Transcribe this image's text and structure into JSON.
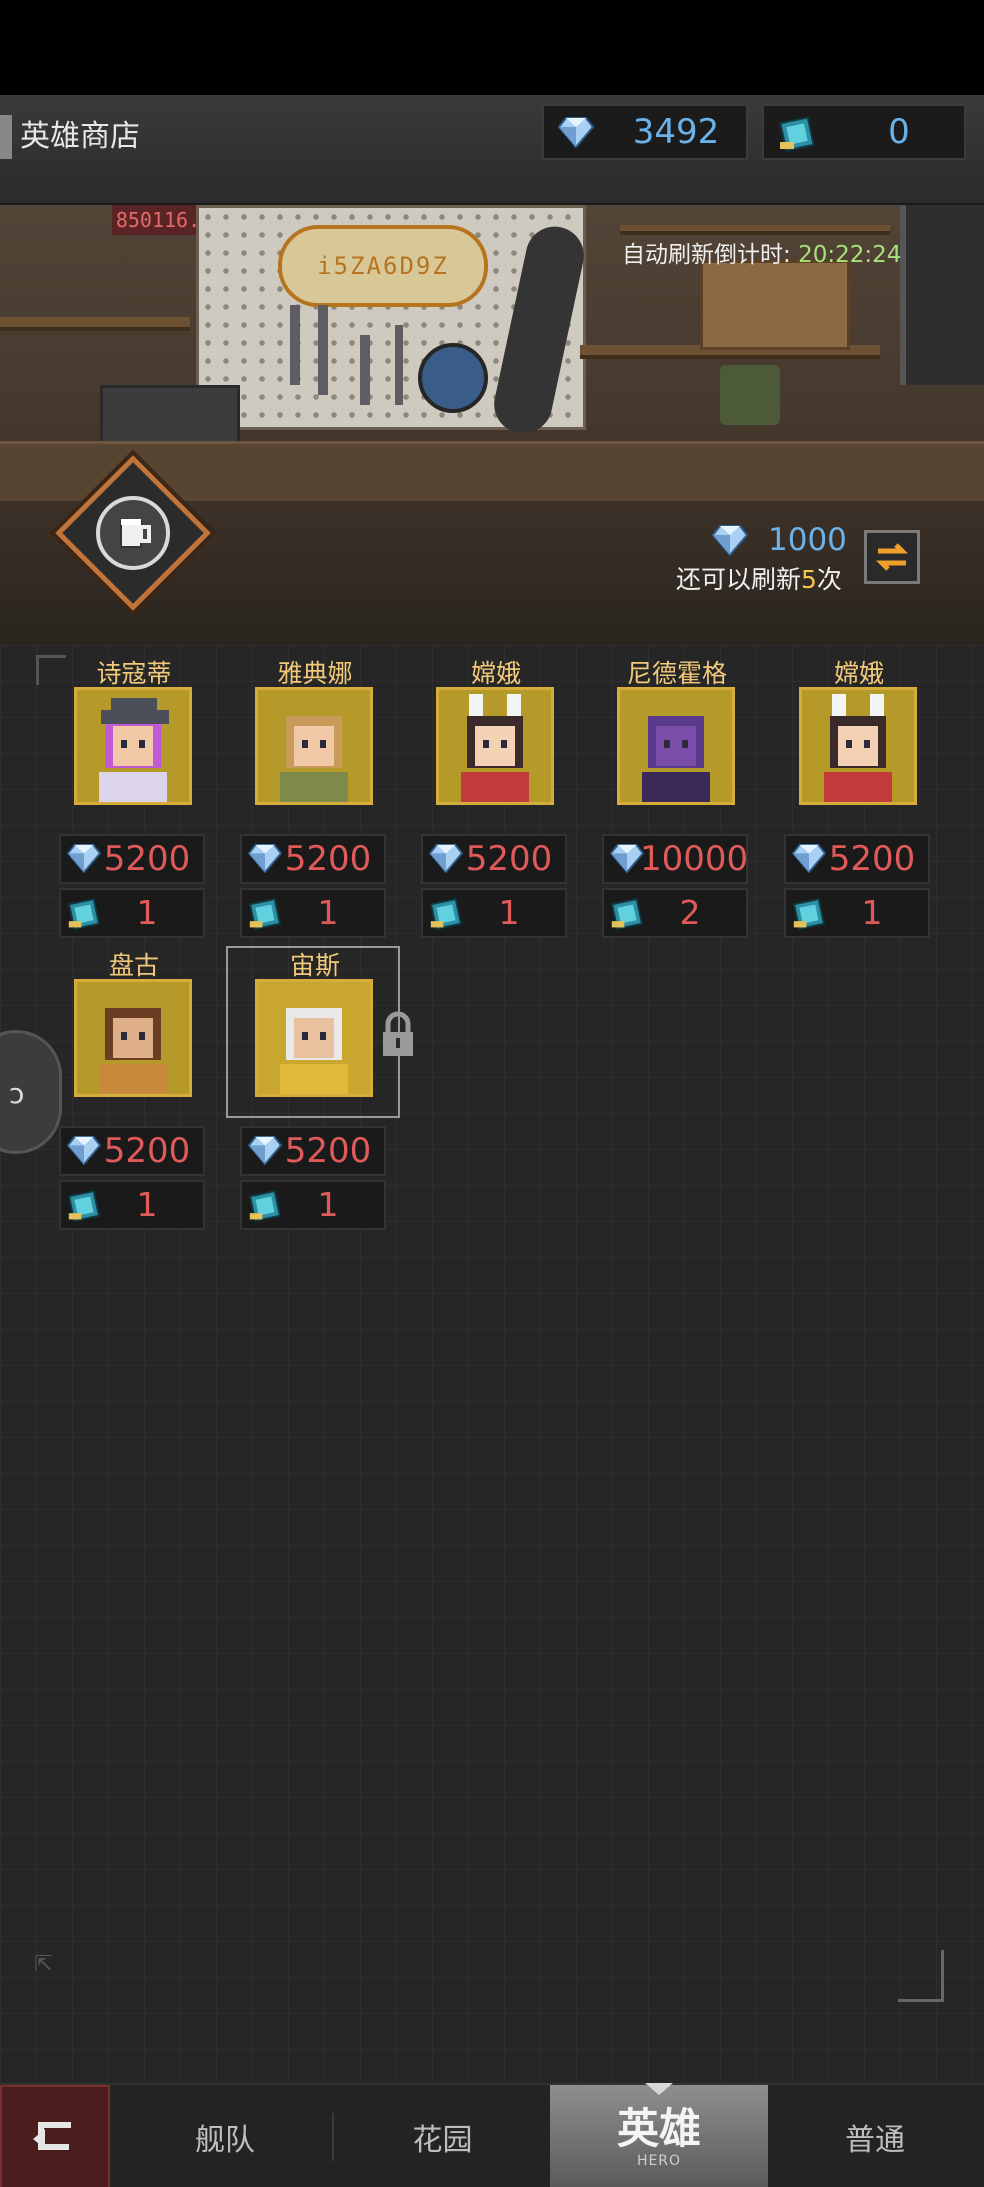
{
  "header": {
    "title": "英雄商店",
    "gems": "3492",
    "tickets": "0"
  },
  "banner": {
    "sign_text": "i5ZA6D9Z",
    "red_sign": "850116.",
    "refresh_timer_label": "自动刷新倒计时:",
    "refresh_timer_value": "20:22:24"
  },
  "refresh": {
    "cost": "1000",
    "remaining_prefix": "还可以刷新",
    "remaining_count": "5",
    "remaining_suffix": "次"
  },
  "heroes": [
    {
      "name": "诗寇蒂",
      "gem_price": "5200",
      "ticket_price": "1",
      "portrait": "purple-hair-hat"
    },
    {
      "name": "雅典娜",
      "gem_price": "5200",
      "ticket_price": "1",
      "portrait": "blonde-staff"
    },
    {
      "name": "嫦娥",
      "gem_price": "5200",
      "ticket_price": "1",
      "portrait": "bunny-ears"
    },
    {
      "name": "尼德霍格",
      "gem_price": "10000",
      "ticket_price": "2",
      "portrait": "purple-dragon"
    },
    {
      "name": "嫦娥",
      "gem_price": "5200",
      "ticket_price": "1",
      "portrait": "bunny-ears"
    },
    {
      "name": "盘古",
      "gem_price": "5200",
      "ticket_price": "1",
      "portrait": "bearded-man"
    },
    {
      "name": "宙斯",
      "gem_price": "5200",
      "ticket_price": "1",
      "portrait": "white-beard-elder"
    }
  ],
  "nav": {
    "back_icon": "return-arrow-icon",
    "fleet": "舰队",
    "garden": "花园",
    "hero": "英雄",
    "hero_sub": "HERO",
    "normal": "普通"
  },
  "colors": {
    "gem_text": "#6ab2e8",
    "price_text": "#e05a5a",
    "name_text": "#f2c97a",
    "portrait_frame": "#d6ad3a",
    "timer_value": "#a8e07a"
  }
}
